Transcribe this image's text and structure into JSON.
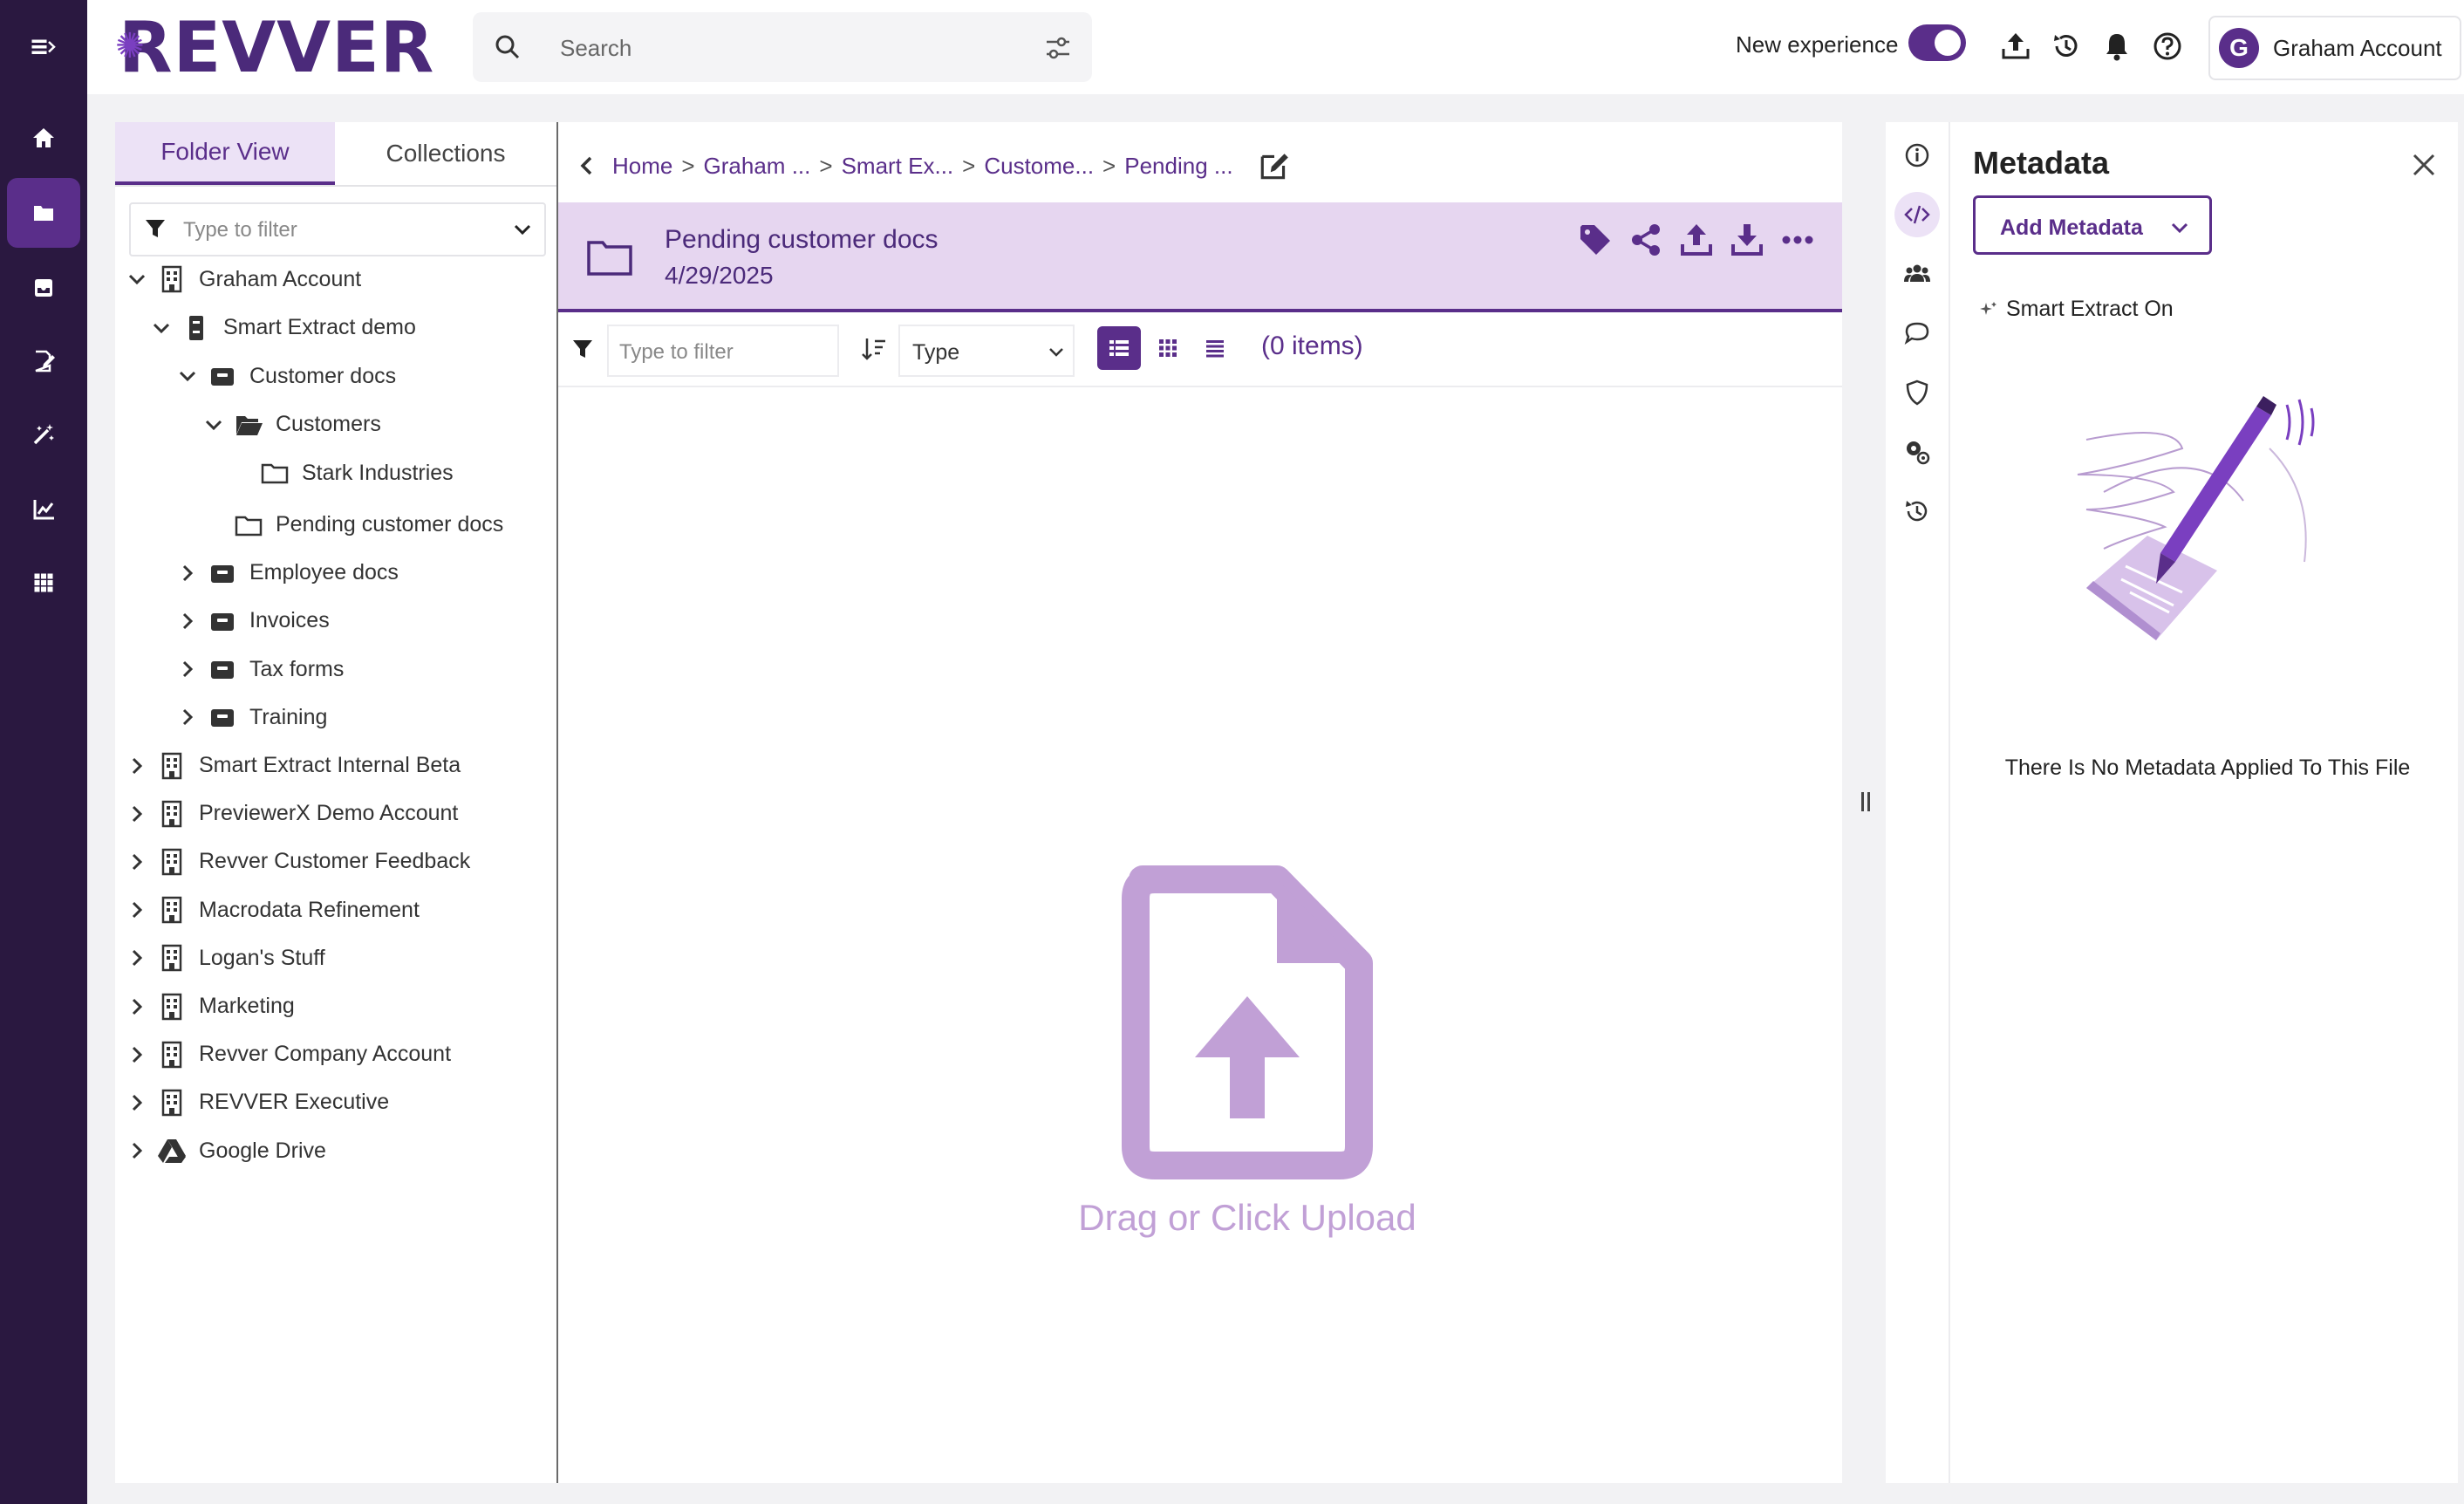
{
  "app": {
    "logo_text": "REVVER",
    "brand_color": "#5a2e8a",
    "rail_color": "#2a1840"
  },
  "rail": {
    "items": [
      {
        "icon": "collapse-menu-icon"
      },
      {
        "icon": "home-icon"
      },
      {
        "icon": "folder-icon",
        "active": true
      },
      {
        "icon": "inbox-icon"
      },
      {
        "icon": "edit-document-icon"
      },
      {
        "icon": "magic-wand-icon"
      },
      {
        "icon": "chart-icon"
      },
      {
        "icon": "apps-grid-icon"
      }
    ]
  },
  "header": {
    "search_placeholder": "Search",
    "new_experience_label": "New experience",
    "new_experience_on": true,
    "account_initial": "G",
    "account_name": "Graham Account"
  },
  "left": {
    "tabs": [
      "Folder View",
      "Collections"
    ],
    "active_tab": 0,
    "filter_placeholder": "Type to filter",
    "tree": [
      {
        "label": "Graham Account",
        "level": 0,
        "expanded": true,
        "icon": "building-icon"
      },
      {
        "label": "Smart Extract demo",
        "level": 1,
        "expanded": true,
        "icon": "cabinet-icon"
      },
      {
        "label": "Customer docs",
        "level": 2,
        "expanded": true,
        "icon": "drawer-icon"
      },
      {
        "label": "Customers",
        "level": 3,
        "expanded": true,
        "icon": "folder-open-icon"
      },
      {
        "label": "Stark Industries",
        "level": 4,
        "icon": "folder-icon"
      },
      {
        "label": "Pending customer docs",
        "level": 3,
        "icon": "folder-icon",
        "selected": true
      },
      {
        "label": "Employee docs",
        "level": 2,
        "expanded": false,
        "icon": "drawer-icon"
      },
      {
        "label": "Invoices",
        "level": 2,
        "expanded": false,
        "icon": "drawer-icon"
      },
      {
        "label": "Tax forms",
        "level": 2,
        "expanded": false,
        "icon": "drawer-icon"
      },
      {
        "label": "Training",
        "level": 2,
        "expanded": false,
        "icon": "drawer-icon"
      },
      {
        "label": "Smart Extract Internal Beta",
        "level": 0,
        "expanded": false,
        "icon": "building-icon"
      },
      {
        "label": "PreviewerX Demo Account",
        "level": 0,
        "expanded": false,
        "icon": "building-icon"
      },
      {
        "label": "Revver Customer Feedback",
        "level": 0,
        "expanded": false,
        "icon": "building-icon"
      },
      {
        "label": "Macrodata Refinement",
        "level": 0,
        "expanded": false,
        "icon": "building-icon"
      },
      {
        "label": "Logan's Stuff",
        "level": 0,
        "expanded": false,
        "icon": "building-icon"
      },
      {
        "label": "Marketing",
        "level": 0,
        "expanded": false,
        "icon": "building-icon"
      },
      {
        "label": "Revver Company Account",
        "level": 0,
        "expanded": false,
        "icon": "building-icon"
      },
      {
        "label": "REVVER Executive",
        "level": 0,
        "expanded": false,
        "icon": "building-icon"
      },
      {
        "label": "Google Drive",
        "level": 0,
        "expanded": false,
        "icon": "google-drive-icon"
      }
    ]
  },
  "center": {
    "breadcrumb": [
      "Home",
      "Graham ...",
      "Smart Ex...",
      "Custome...",
      "Pending ..."
    ],
    "breadcrumb_sep": ">",
    "folder_title": "Pending customer docs",
    "folder_date": "4/29/2025",
    "header_actions": [
      "tag-icon",
      "share-icon",
      "upload-icon",
      "download-icon",
      "more-icon"
    ],
    "filter_placeholder": "Type to filter",
    "type_select": "Type",
    "views": [
      "list-view-icon",
      "grid-view-icon",
      "compact-view-icon"
    ],
    "active_view": 0,
    "item_count": "(0 items)",
    "drop_text": "Drag or Click Upload"
  },
  "panel_strip": [
    "info-icon",
    "code-icon",
    "users-icon",
    "comment-icon",
    "shield-icon",
    "workflow-icon",
    "history-icon"
  ],
  "panel_strip_active": 1,
  "metadata": {
    "title": "Metadata",
    "add_button": "Add Metadata",
    "smart_extract": "Smart Extract On",
    "empty_message": "There Is No Metadata Applied To This File"
  }
}
